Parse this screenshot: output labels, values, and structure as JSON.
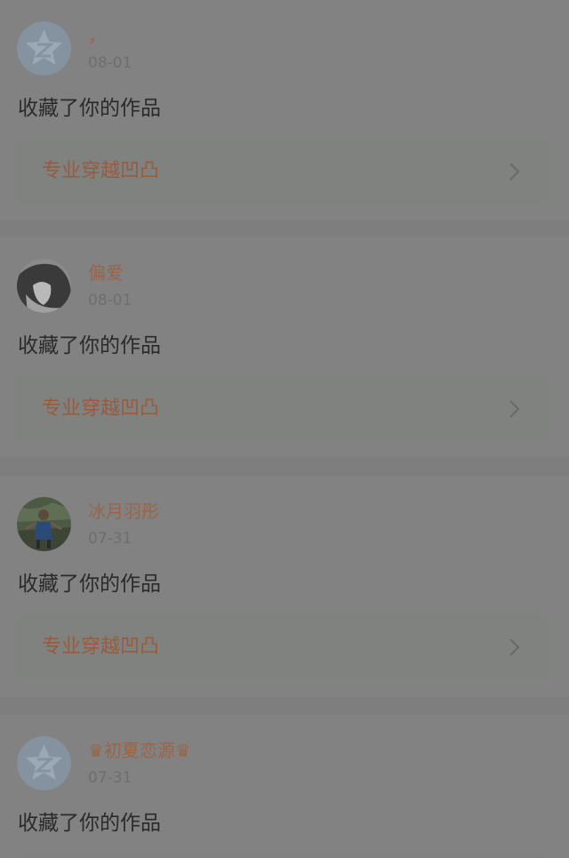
{
  "feed": {
    "items": [
      {
        "name": "，",
        "date": "08-01",
        "action": "收藏了你的作品",
        "work_title": "专业穿越凹凸",
        "avatar": "qzone-default-avatar"
      },
      {
        "name": "偏爱",
        "date": "08-01",
        "action": "收藏了你的作品",
        "work_title": "专业穿越凹凸",
        "avatar": "user-photo-avatar"
      },
      {
        "name": "冰月羽彤",
        "date": "07-31",
        "action": "收藏了你的作品",
        "work_title": "专业穿越凹凸",
        "avatar": "user-photo-avatar"
      },
      {
        "name": "♛初夏恋源♛",
        "date": "07-31",
        "action": "收藏了你的作品",
        "work_title": "",
        "avatar": "qzone-default-avatar"
      }
    ]
  },
  "colors": {
    "page_background": "#7e7e7e",
    "card_background": "#828282",
    "name_color": "#9a6448",
    "work_title_color": "#9a5a3c"
  }
}
